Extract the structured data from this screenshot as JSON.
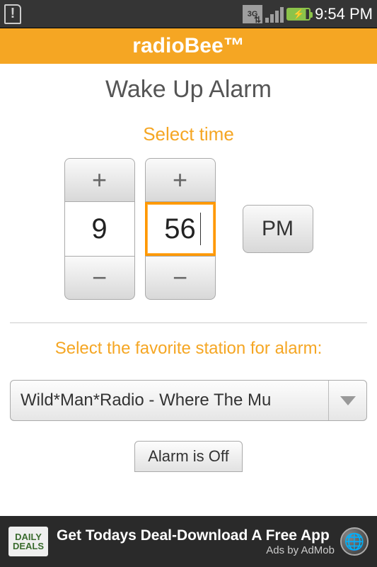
{
  "status": {
    "network_label": "3G",
    "clock": "9:54 PM"
  },
  "header": {
    "title": "radioBee™"
  },
  "main": {
    "title": "Wake Up Alarm",
    "select_time_label": "Select time",
    "hour_value": "9",
    "minute_value": "56",
    "ampm": "PM",
    "select_station_label": "Select the favorite station for alarm:",
    "station_selected": "Wild*Man*Radio - Where The Mu",
    "alarm_toggle_label": "Alarm is Off"
  },
  "ad": {
    "badge_line1": "DAILY",
    "badge_line2": "DEALS",
    "text": "Get Todays Deal-Download A Free App",
    "sub": "Ads by AdMob"
  }
}
